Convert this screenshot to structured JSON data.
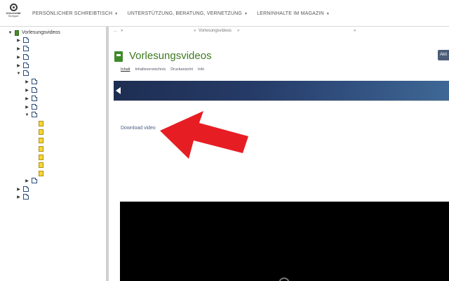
{
  "logo": {
    "line1": "Universität",
    "line2": "Stuttgart"
  },
  "nav": {
    "items": [
      {
        "label": "PERSÖNLICHER SCHREIBTISCH"
      },
      {
        "label": "UNTERSTÜTZUNG, BERATUNG, VERNETZUNG"
      },
      {
        "label": "LERNINHALTE IM MAGAZIN"
      }
    ]
  },
  "tree": {
    "root_label": "Vorlesungsvideos"
  },
  "breadcrumb": {
    "first": "...",
    "sep1": "»",
    "sep2": "»",
    "current": "Vorlesungsvideos",
    "sep3": "»",
    "sep4": "»"
  },
  "page": {
    "title": "Vorlesungsvideos",
    "actions_label": "Akti"
  },
  "tabs": [
    {
      "label": "Inhalt"
    },
    {
      "label": "Inhaltsverzeichnis"
    },
    {
      "label": "Druckansicht"
    },
    {
      "label": "Info"
    }
  ],
  "content": {
    "download_label": "Download video"
  },
  "colors": {
    "accent_green": "#3e7a1f",
    "arrow_red": "#e61e24",
    "banner_blue": "#253a66"
  }
}
